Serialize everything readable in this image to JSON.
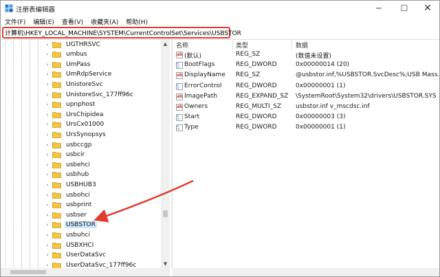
{
  "window": {
    "title": "注册表编辑器",
    "minimize": "─",
    "maximize": "☐",
    "close": "✕"
  },
  "menu": [
    "文件(F)",
    "编辑(E)",
    "查看(V)",
    "收藏夹(A)",
    "帮助(H)"
  ],
  "address": "计算机\\HKEY_LOCAL_MACHINE\\SYSTEM\\CurrentControlSet\\Services\\USBSTOR",
  "tree": {
    "items": [
      {
        "label": "UGTHRSVC",
        "selected": false
      },
      {
        "label": "umbus",
        "selected": false
      },
      {
        "label": "UmPass",
        "selected": false
      },
      {
        "label": "UmRdpService",
        "selected": false
      },
      {
        "label": "UnistoreSvc",
        "selected": false
      },
      {
        "label": "UnistoreSvc_177ff96c",
        "selected": false
      },
      {
        "label": "upnphost",
        "selected": false
      },
      {
        "label": "UrsChipidea",
        "selected": false
      },
      {
        "label": "UrsCx01000",
        "selected": false
      },
      {
        "label": "UrsSynopsys",
        "selected": false
      },
      {
        "label": "usbccgp",
        "selected": false
      },
      {
        "label": "usbcir",
        "selected": false
      },
      {
        "label": "usbehci",
        "selected": false
      },
      {
        "label": "usbhub",
        "selected": false
      },
      {
        "label": "USBHUB3",
        "selected": false
      },
      {
        "label": "usbohci",
        "selected": false
      },
      {
        "label": "usbprint",
        "selected": false
      },
      {
        "label": "usbser",
        "selected": false
      },
      {
        "label": "USBSTOR",
        "selected": true
      },
      {
        "label": "usbuhci",
        "selected": false
      },
      {
        "label": "USBXHCI",
        "selected": false
      },
      {
        "label": "UserDataSvc",
        "selected": false
      },
      {
        "label": "UserDataSvc_177ff96c",
        "selected": false
      }
    ]
  },
  "list": {
    "headers": {
      "name": "名称",
      "type": "类型",
      "data": "数据"
    },
    "rows": [
      {
        "icon": "string-value-icon",
        "name": "(默认)",
        "type": "REG_SZ",
        "data": "(数值未设置)"
      },
      {
        "icon": "binary-value-icon",
        "name": "BootFlags",
        "type": "REG_DWORD",
        "data": "0x00000014 (20)"
      },
      {
        "icon": "string-value-icon",
        "name": "DisplayName",
        "type": "REG_SZ",
        "data": "@usbstor.inf,%USBSTOR.SvcDesc%;USB Mass..."
      },
      {
        "icon": "binary-value-icon",
        "name": "ErrorControl",
        "type": "REG_DWORD",
        "data": "0x00000001 (1)"
      },
      {
        "icon": "string-value-icon",
        "name": "ImagePath",
        "type": "REG_EXPAND_SZ",
        "data": "\\SystemRoot\\System32\\drivers\\USBSTOR.SYS"
      },
      {
        "icon": "string-value-icon",
        "name": "Owners",
        "type": "REG_MULTI_SZ",
        "data": "usbstor.inf v_mscdsc.inf"
      },
      {
        "icon": "binary-value-icon",
        "name": "Start",
        "type": "REG_DWORD",
        "data": "0x00000003 (3)"
      },
      {
        "icon": "binary-value-icon",
        "name": "Type",
        "type": "REG_DWORD",
        "data": "0x00000001 (1)"
      }
    ]
  },
  "colors": {
    "highlight": "#cce8ff",
    "annotation_red": "#e23b2e",
    "folder": "#f4c542"
  }
}
